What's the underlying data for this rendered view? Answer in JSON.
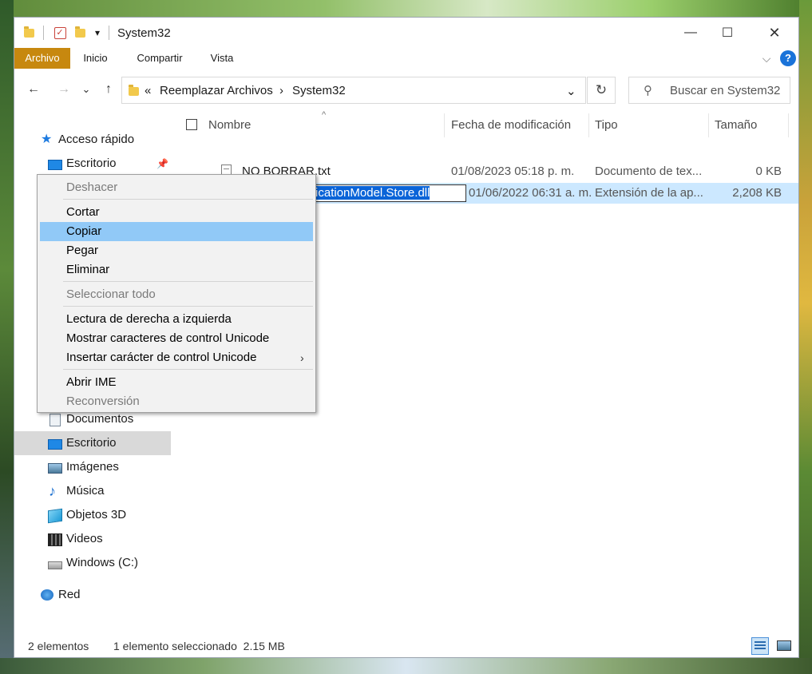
{
  "window": {
    "title": "System32"
  },
  "titlebar": {
    "minimize": "—",
    "maximize": "☐",
    "close": "✕",
    "dropdown": "▾"
  },
  "ribbon": {
    "tabs": [
      {
        "label": "Archivo",
        "active": true
      },
      {
        "label": "Inicio"
      },
      {
        "label": "Compartir"
      },
      {
        "label": "Vista"
      }
    ],
    "collapse": "⌵",
    "help": "?"
  },
  "nav": {
    "back": "←",
    "forward": "→",
    "recent": "⌄",
    "up": "↑"
  },
  "address": {
    "prefix": "«",
    "crumbs": [
      "Reemplazar Archivos",
      "System32"
    ],
    "separator": "›",
    "dropdown": "⌄",
    "refresh": "↻"
  },
  "search": {
    "placeholder": "Buscar en System32"
  },
  "sidebar": {
    "items": [
      {
        "label": "Acceso rápido",
        "icon": "star-icon"
      },
      {
        "label": "Escritorio",
        "icon": "desktop-icon",
        "pinned": true
      },
      {
        "label": "Documentos",
        "icon": "documents-icon"
      },
      {
        "label": "Escritorio",
        "icon": "desktop-icon",
        "selected": true
      },
      {
        "label": "Imágenes",
        "icon": "pictures-icon"
      },
      {
        "label": "Música",
        "icon": "music-icon"
      },
      {
        "label": "Objetos 3D",
        "icon": "3d-objects-icon"
      },
      {
        "label": "Videos",
        "icon": "videos-icon"
      },
      {
        "label": "Windows (C:)",
        "icon": "drive-icon"
      },
      {
        "label": "Red",
        "icon": "network-icon"
      }
    ]
  },
  "filelist": {
    "columns": [
      "Nombre",
      "Fecha de modificación",
      "Tipo",
      "Tamaño"
    ],
    "rows": [
      {
        "name": "NO BORRAR.txt",
        "date": "01/08/2023 05:18 p. m.",
        "type": "Documento de tex...",
        "size": "0 KB"
      },
      {
        "name": "Windows.ApplicationModel.Store.dll",
        "date": "01/06/2022 06:31 a. m.",
        "type": "Extensión de la ap...",
        "size": "2,208 KB",
        "selected": true,
        "renaming": true
      }
    ]
  },
  "context_menu": {
    "items": [
      {
        "label": "Deshacer",
        "disabled": true
      },
      {
        "label": "Cortar"
      },
      {
        "label": "Copiar",
        "highlighted": true
      },
      {
        "label": "Pegar"
      },
      {
        "label": "Eliminar"
      },
      {
        "label": "Seleccionar todo",
        "disabled": true
      },
      {
        "label": "Lectura de derecha a izquierda"
      },
      {
        "label": "Mostrar caracteres de control Unicode"
      },
      {
        "label": "Insertar carácter de control Unicode",
        "submenu": "›"
      },
      {
        "label": "Abrir IME"
      },
      {
        "label": "Reconversión",
        "disabled": true
      }
    ]
  },
  "statusbar": {
    "count": "2 elementos",
    "selection": "1 elemento seleccionado  2.15 MB"
  },
  "colors": {
    "archivo_tab": "#c7880f",
    "selection": "#cce8ff",
    "menu_highlight": "#91c9f7",
    "help": "#1a73d9"
  }
}
